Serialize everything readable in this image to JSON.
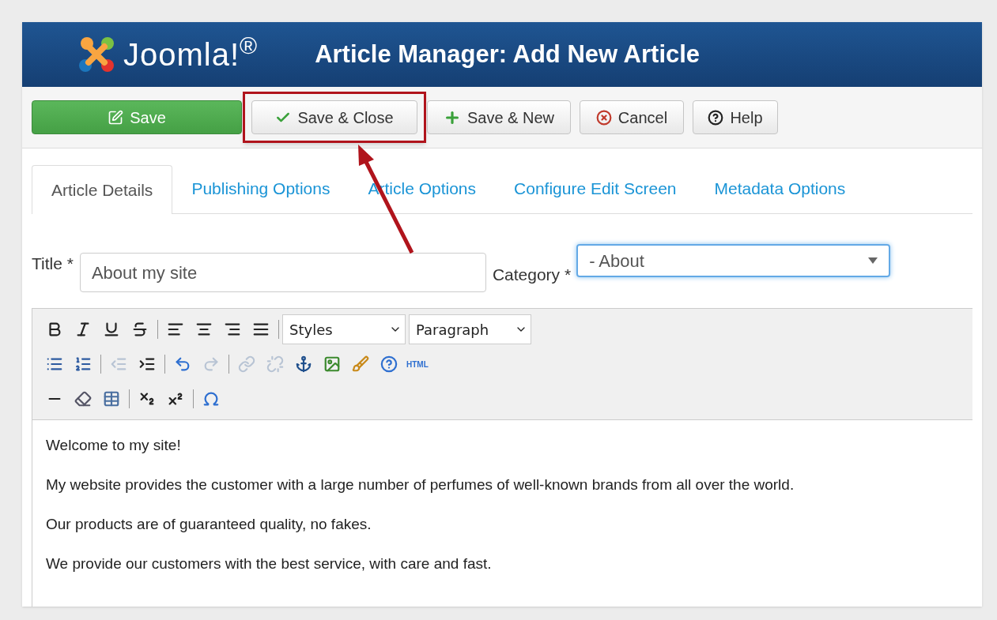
{
  "header": {
    "logo_text": "Joomla!$^{®}$",
    "title": "Article Manager: Add New Article"
  },
  "toolbar": [
    {
      "label": "Save",
      "kind": "primary",
      "highlighted": false
    },
    {
      "label": "Save & Close",
      "kind": "check",
      "highlighted": true
    },
    {
      "label": "Save & New",
      "kind": "plus",
      "highlighted": false
    },
    {
      "label": "Cancel",
      "kind": "cancel",
      "highlighted": false
    },
    {
      "label": "Help",
      "kind": "help",
      "highlighted": false
    }
  ],
  "tabs": [
    {
      "label": "Article Details",
      "selected": true
    },
    {
      "label": "Publishing Options",
      "selected": false
    },
    {
      "label": "Article Options",
      "selected": false
    },
    {
      "label": "Configure Edit Screen",
      "selected": false
    },
    {
      "label": "Metadata Options",
      "selected": false
    }
  ],
  "title_field": {
    "label": "Title *",
    "value": "About my site"
  },
  "category_field": {
    "label": "Category *",
    "value": "- About",
    "focused": true
  },
  "editor": {
    "styles": "Styles",
    "format": "Paragraph",
    "html_label": "HTML",
    "tools": [
      {
        "disabled": true
      },
      {
        "disabled": false
      },
      {
        "disabled": false
      },
      {
        "disabled": true
      },
      {
        "disabled": true
      },
      {
        "disabled": true
      },
      {
        "disabled": false
      },
      {
        "disabled": false
      },
      {
        "disabled": false
      },
      {
        "disabled": false
      },
      {
        "disabled": false
      },
      {
        "disabled": false
      }
    ],
    "paragraphs": [
      "Welcome to my site!",
      "My website provides the customer with a large number of perfumes of well-known brands from all over the world.",
      "Our products are of guaranteed quality, no fakes.",
      "We provide our customers with the best service, with care and fast."
    ]
  }
}
